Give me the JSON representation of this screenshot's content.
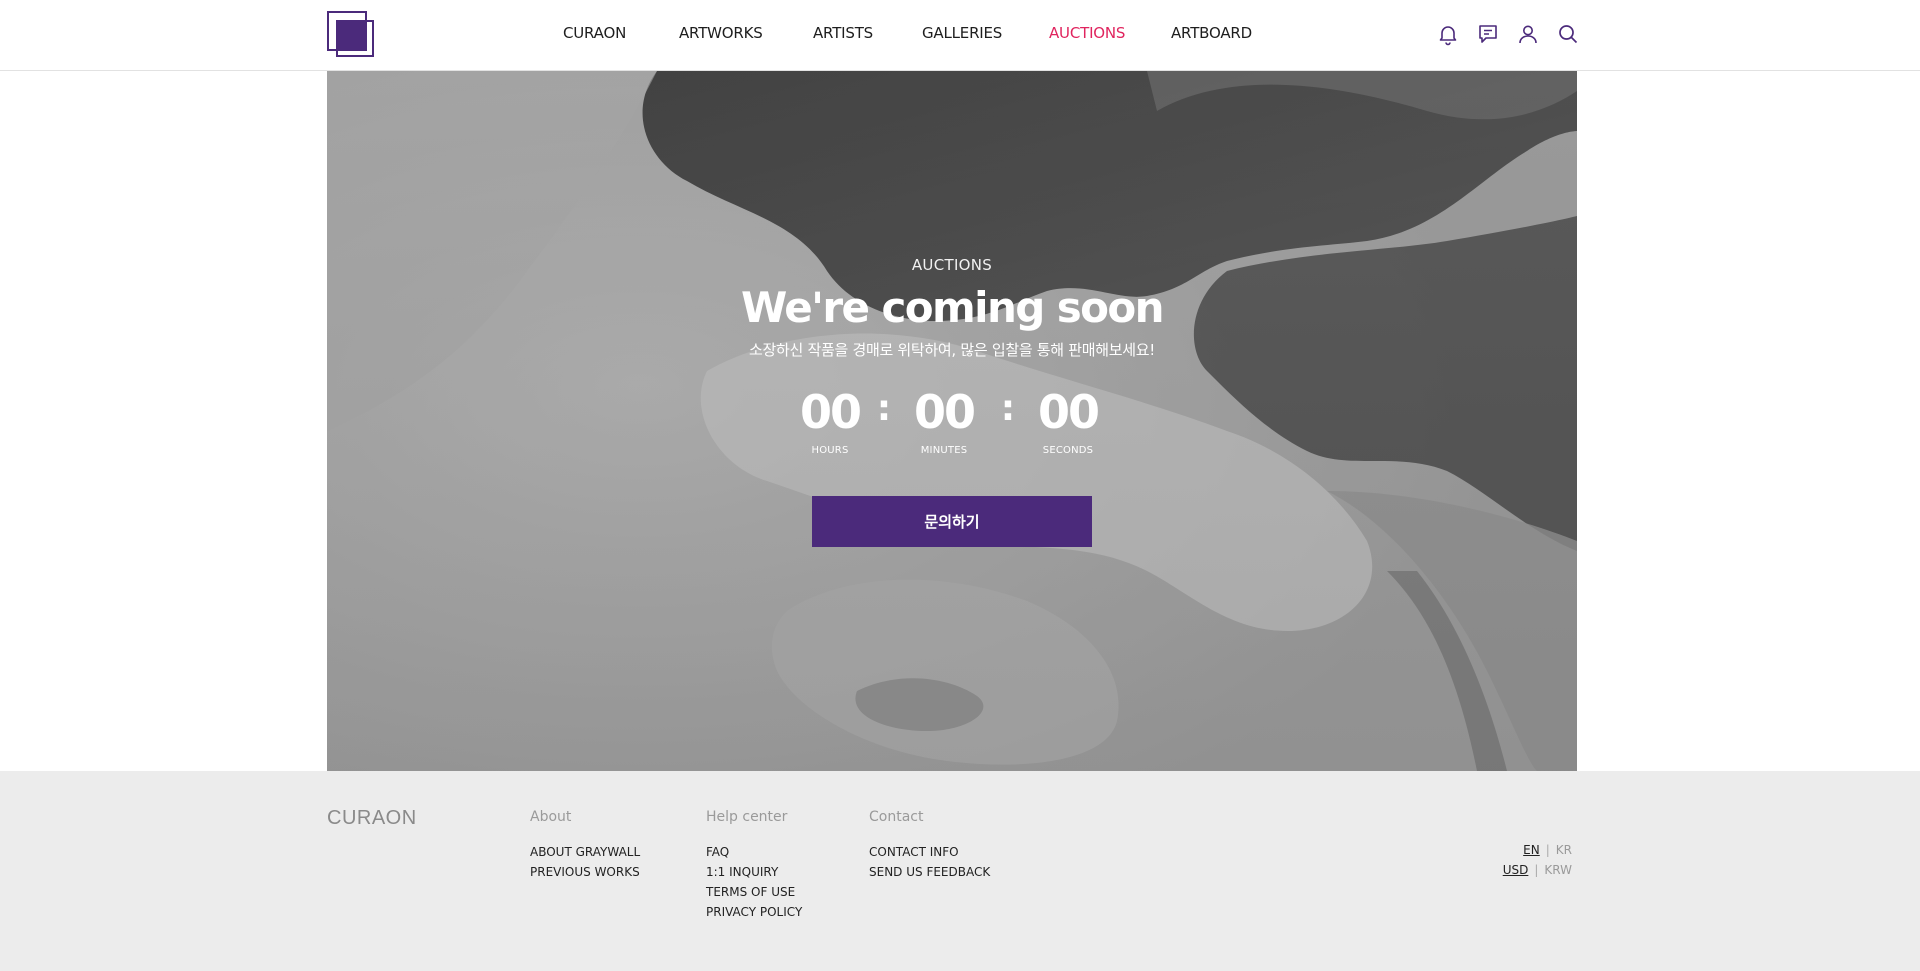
{
  "header": {
    "nav": [
      {
        "label": "CURAON",
        "active": false
      },
      {
        "label": "ARTWORKS",
        "active": false
      },
      {
        "label": "ARTISTS",
        "active": false
      },
      {
        "label": "GALLERIES",
        "active": false
      },
      {
        "label": "AUCTIONS",
        "active": true
      },
      {
        "label": "ARTBOARD",
        "active": false
      }
    ],
    "icons": [
      "bell-icon",
      "message-icon",
      "user-icon",
      "search-icon"
    ],
    "colors": {
      "brand": "#4b2a7b",
      "active": "#e0245e"
    }
  },
  "hero": {
    "eyebrow": "AUCTIONS",
    "headline": "We're coming soon",
    "subline": "소장하신 작품을 경매로 위탁하여, 많은 입찰을 통해 판매해보세요!",
    "countdown": {
      "hours": "00",
      "minutes": "00",
      "seconds": "00",
      "separator": ":",
      "hours_label": "HOURS",
      "minutes_label": "MINUTES",
      "seconds_label": "SECONDS"
    },
    "cta_label": "문의하기"
  },
  "footer": {
    "brand": "CURAON",
    "about": {
      "heading": "About",
      "links": [
        "ABOUT GRAYWALL",
        "PREVIOUS WORKS"
      ]
    },
    "help": {
      "heading": "Help center",
      "links": [
        "FAQ",
        "1:1 INQUIRY",
        "TERMS OF USE",
        "PRIVACY POLICY"
      ]
    },
    "contact": {
      "heading": "Contact",
      "links": [
        "CONTACT INFO",
        "SEND US FEEDBACK"
      ]
    },
    "language": {
      "selected": "EN",
      "other": "KR",
      "separator": "|"
    },
    "currency": {
      "selected": "USD",
      "other": "KRW",
      "separator": "|"
    }
  }
}
